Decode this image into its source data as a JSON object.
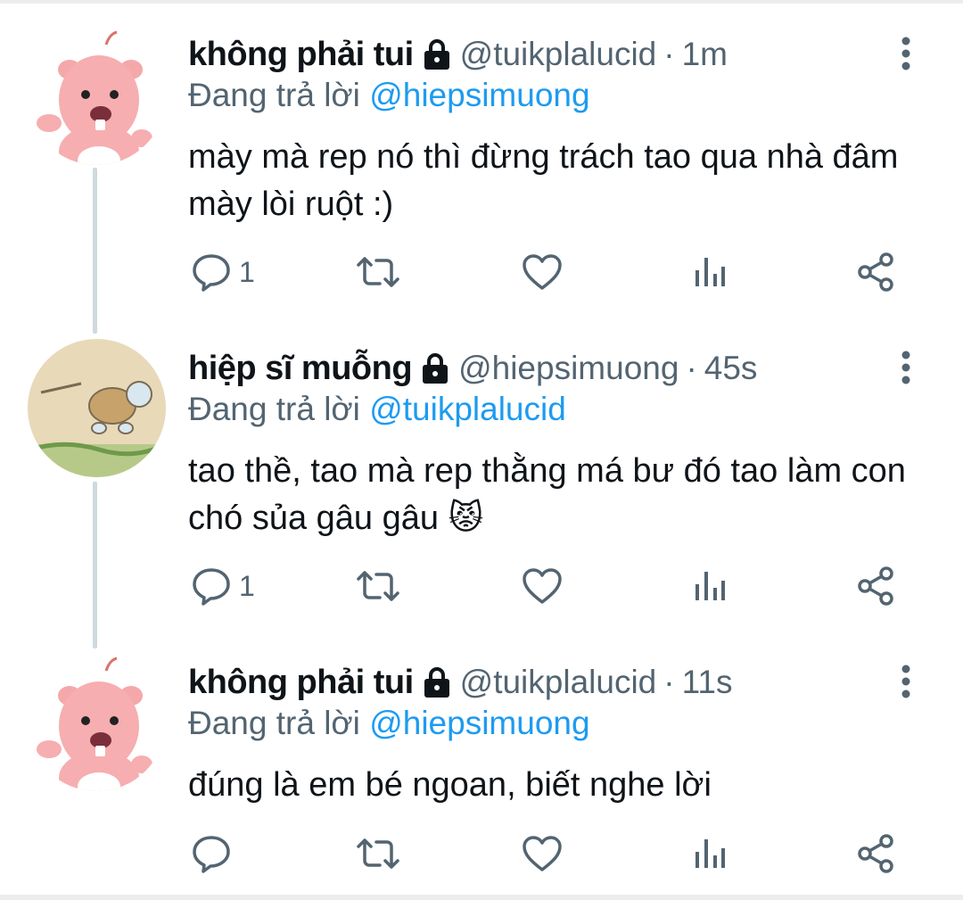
{
  "thread": {
    "tweets": [
      {
        "display_name": "không phải tui",
        "handle": "@tuikplalucid",
        "separator": "·",
        "time": "1m",
        "reply_prefix": "Đang trả lời",
        "reply_to": "@hiepsimuong",
        "text": "mày mà rep nó thì đừng trách tao qua nhà đâm mày lòi ruột :)",
        "reply_count": "1",
        "avatar_icon": "pink-beaver-avatar"
      },
      {
        "display_name": "hiệp sĩ muỗng",
        "handle": "@hiepsimuong",
        "separator": "·",
        "time": "45s",
        "reply_prefix": "Đang trả lời",
        "reply_to": "@tuikplalucid",
        "text": "tao thề, tao mà rep thằng má bư đó tao làm con chó sủa gâu gâu 😾",
        "reply_count": "1",
        "avatar_icon": "turtle-drawing-avatar"
      },
      {
        "display_name": "không phải tui",
        "handle": "@tuikplalucid",
        "separator": "·",
        "time": "11s",
        "reply_prefix": "Đang trả lời",
        "reply_to": "@hiepsimuong",
        "text": "đúng là em bé ngoan, biết nghe lời",
        "reply_count": "",
        "avatar_icon": "pink-beaver-avatar"
      }
    ]
  },
  "colors": {
    "text_primary": "#0f1419",
    "text_secondary": "#536471",
    "mention": "#1d9bf0",
    "thread_line": "#cfd9de"
  }
}
